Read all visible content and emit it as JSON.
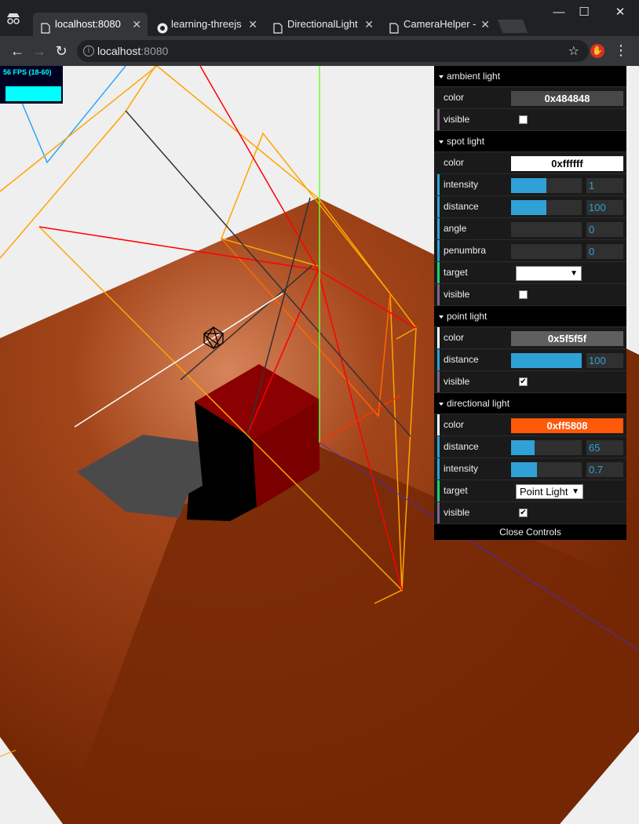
{
  "browser": {
    "tabs": [
      {
        "title": "localhost:8080",
        "active": true,
        "icon": "page-icon"
      },
      {
        "title": "learning-threejs",
        "active": false,
        "icon": "github-icon"
      },
      {
        "title": "DirectionalLight",
        "active": false,
        "icon": "page-icon"
      },
      {
        "title": "CameraHelper -",
        "active": false,
        "icon": "page-icon"
      }
    ],
    "url_host": "localhost",
    "url_rest": ":8080",
    "window_controls": {
      "minimize": "—",
      "maximize": "☐",
      "close": "✕"
    },
    "nav": {
      "back": "←",
      "forward": "→",
      "reload": "↻"
    }
  },
  "stats": {
    "fps_text": "56 FPS (18-60)"
  },
  "gui": {
    "folders": [
      {
        "title": "ambient light",
        "rows": [
          {
            "label": "color",
            "type": "color",
            "value": "0x484848",
            "bg": "#484848",
            "fg": "#ffffff",
            "strip": "#1a1a1a"
          },
          {
            "label": "visible",
            "type": "checkbox",
            "checked": false,
            "strip": "#806787"
          }
        ]
      },
      {
        "title": "spot light",
        "rows": [
          {
            "label": "color",
            "type": "color",
            "value": "0xffffff",
            "bg": "#ffffff",
            "fg": "#000000",
            "strip": "#1a1a1a"
          },
          {
            "label": "intensity",
            "type": "number",
            "value": "1",
            "fill": 0.5,
            "strip": "#2fa1d6"
          },
          {
            "label": "distance",
            "type": "number",
            "value": "100",
            "fill": 0.5,
            "strip": "#2fa1d6"
          },
          {
            "label": "angle",
            "type": "number",
            "value": "0",
            "fill": 0,
            "strip": "#2fa1d6"
          },
          {
            "label": "penumbra",
            "type": "number",
            "value": "0",
            "fill": 0,
            "strip": "#2fa1d6"
          },
          {
            "label": "target",
            "type": "select",
            "value": "",
            "strip": "#1ed36f"
          },
          {
            "label": "visible",
            "type": "checkbox",
            "checked": false,
            "strip": "#806787"
          }
        ]
      },
      {
        "title": "point light",
        "rows": [
          {
            "label": "color",
            "type": "color",
            "value": "0x5f5f5f",
            "bg": "#5f5f5f",
            "fg": "#ffffff",
            "strip": "#ffffff"
          },
          {
            "label": "distance",
            "type": "number",
            "value": "100",
            "fill": 1,
            "strip": "#2fa1d6"
          },
          {
            "label": "visible",
            "type": "checkbox",
            "checked": true,
            "strip": "#806787"
          }
        ]
      },
      {
        "title": "directional light",
        "rows": [
          {
            "label": "color",
            "type": "color",
            "value": "0xff5808",
            "bg": "#ff5808",
            "fg": "#ffffff",
            "strip": "#ffffff"
          },
          {
            "label": "distance",
            "type": "number",
            "value": "65",
            "fill": 0.33,
            "strip": "#2fa1d6"
          },
          {
            "label": "intensity",
            "type": "number",
            "value": "0.7",
            "fill": 0.37,
            "strip": "#2fa1d6"
          },
          {
            "label": "target",
            "type": "select",
            "value": "Point Light",
            "strip": "#1ed36f"
          },
          {
            "label": "visible",
            "type": "checkbox",
            "checked": true,
            "strip": "#806787"
          }
        ]
      }
    ],
    "close_label": "Close Controls"
  },
  "colors": {
    "plane_light": "#c8704a",
    "plane_dark": "#7a2a05",
    "cube": "#8b0000",
    "background": "#efefef"
  }
}
